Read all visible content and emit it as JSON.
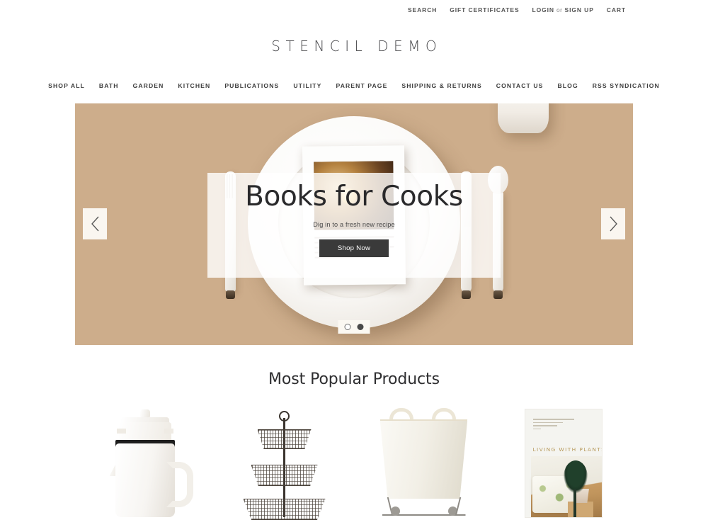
{
  "topbar": {
    "links": [
      {
        "label": "SEARCH",
        "name": "search"
      },
      {
        "label": "GIFT CERTIFICATES",
        "name": "gift-certificates"
      }
    ],
    "login": "LOGIN",
    "or": "or",
    "signup": "SIGN UP",
    "cart": "CART"
  },
  "brand": {
    "logo": "STENCIL DEMO"
  },
  "nav": {
    "items": [
      {
        "label": "SHOP ALL",
        "name": "shop-all"
      },
      {
        "label": "BATH",
        "name": "bath"
      },
      {
        "label": "GARDEN",
        "name": "garden"
      },
      {
        "label": "KITCHEN",
        "name": "kitchen"
      },
      {
        "label": "PUBLICATIONS",
        "name": "publications"
      },
      {
        "label": "UTILITY",
        "name": "utility"
      },
      {
        "label": "PARENT PAGE",
        "name": "parent-page"
      },
      {
        "label": "SHIPPING & RETURNS",
        "name": "shipping-returns"
      },
      {
        "label": "CONTACT US",
        "name": "contact-us"
      },
      {
        "label": "BLOG",
        "name": "blog"
      },
      {
        "label": "RSS SYNDICATION",
        "name": "rss-syndication"
      }
    ]
  },
  "hero": {
    "title": "Books for Cooks",
    "subtitle": "Dig in to a fresh new recipe",
    "cta": "Shop Now",
    "background_color": "#cdad8b",
    "overlay_color": "rgba(255,255,255,0.80)",
    "cta_color": "#3a3a3a",
    "prev_label": "Previous slide",
    "next_label": "Next slide",
    "slides": [
      {
        "index": 1,
        "active": false
      },
      {
        "index": 2,
        "active": true
      }
    ]
  },
  "popular": {
    "heading": "Most Popular Products",
    "products": [
      {
        "name": "coffee-press",
        "alt": "White and black coffee press carafe"
      },
      {
        "name": "tiered-wire-basket-stand",
        "alt": "Three tier wire basket stand"
      },
      {
        "name": "canvas-laundry-cart",
        "alt": "Canvas laundry cart on wheels"
      },
      {
        "name": "living-with-plants-book",
        "alt": "Living With Plants book cover",
        "cover_title": "LIVING WITH PLANTS"
      }
    ]
  }
}
